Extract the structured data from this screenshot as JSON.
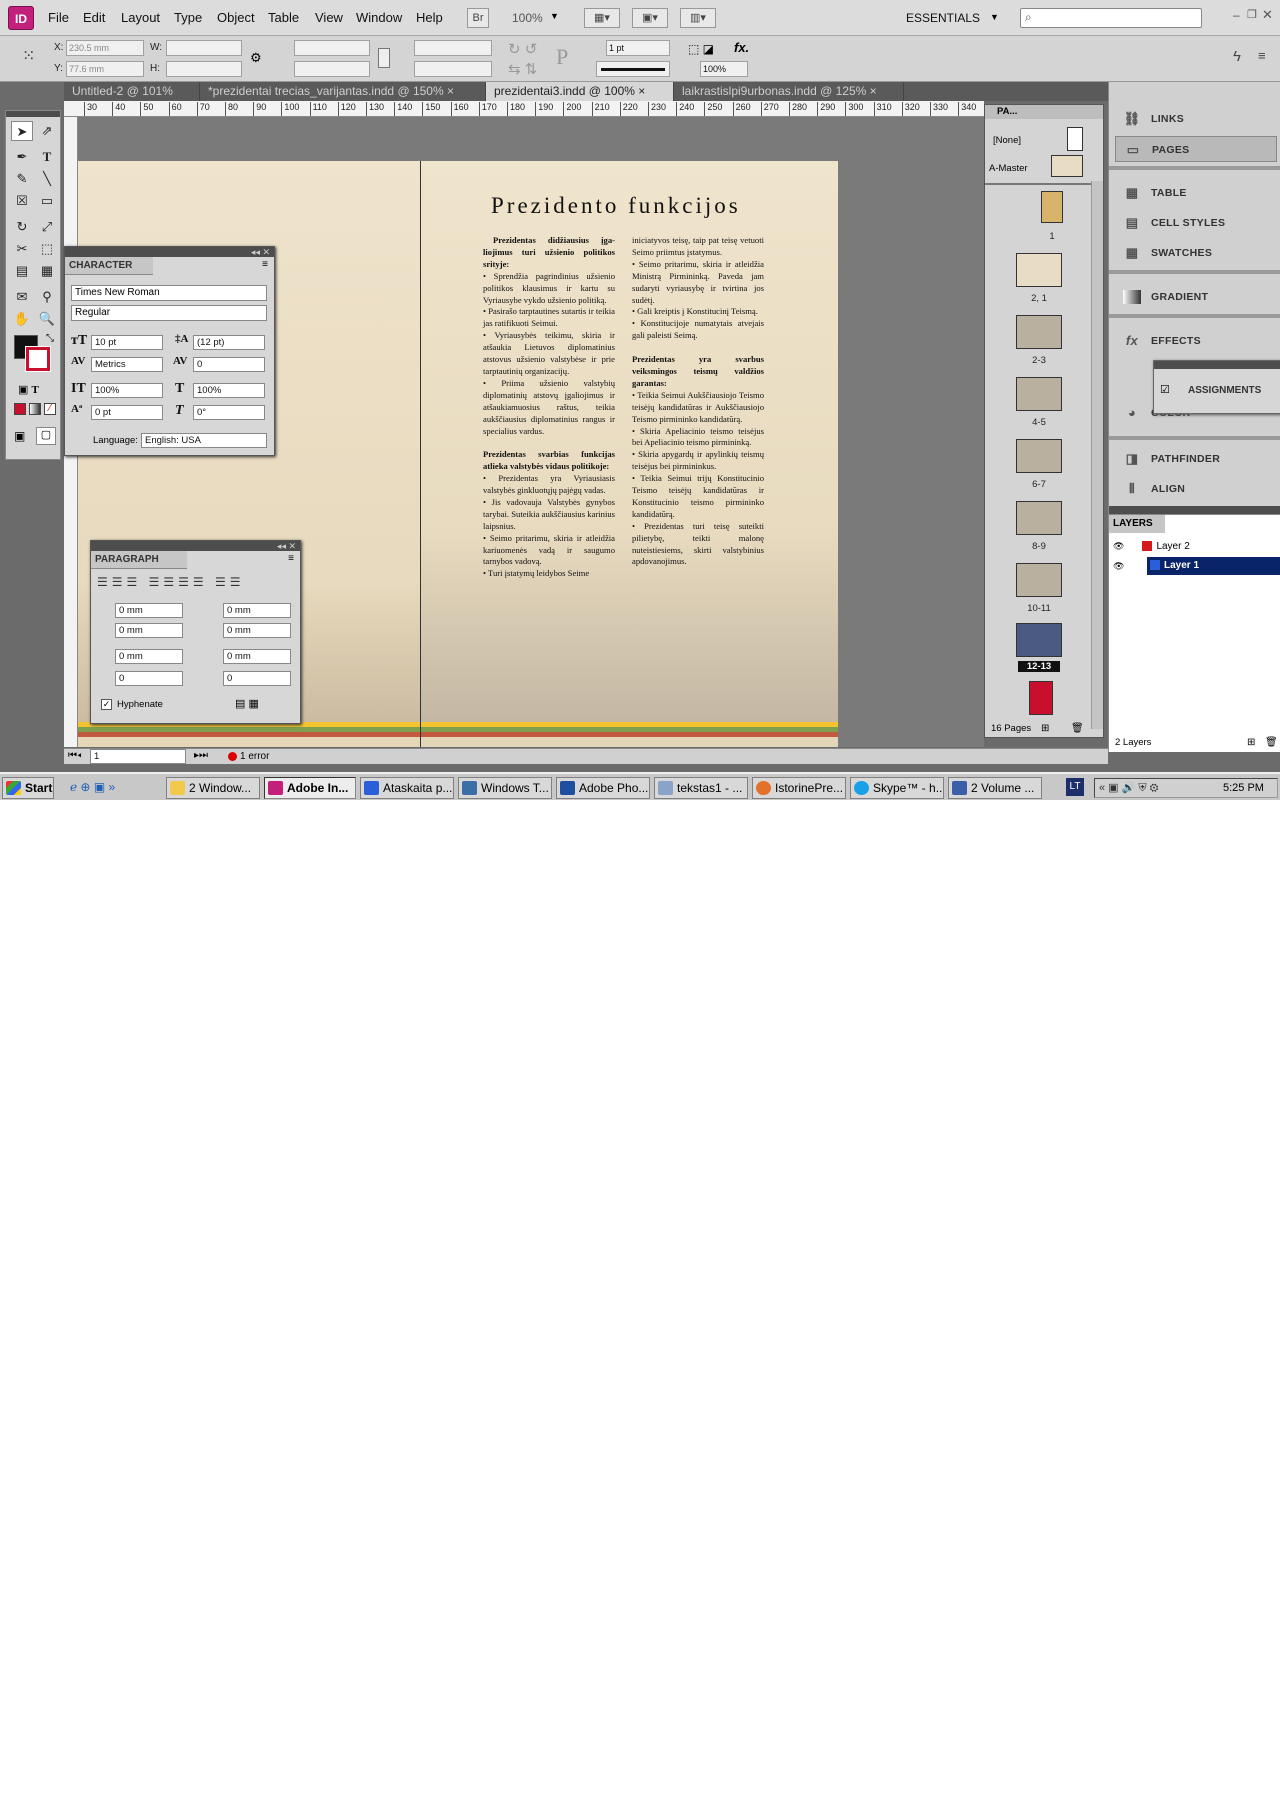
{
  "app": {
    "logo": "ID",
    "menus": [
      "File",
      "Edit",
      "Layout",
      "Type",
      "Object",
      "Table",
      "View",
      "Window",
      "Help"
    ],
    "bridge": "Br",
    "zoom": "100%",
    "workspace": "ESSENTIALS"
  },
  "control": {
    "x": "230.5 mm",
    "y": "77.6 mm",
    "x_label": "X:",
    "y_label": "Y:",
    "w_label": "W:",
    "h_label": "H:",
    "stroke_weight": "1 pt",
    "opacity": "100%"
  },
  "tabs": [
    "Untitled-2 @ 101%",
    "*prezidentai trecias_varijantas.indd @ 150%",
    "prezidentai3.indd @ 100%",
    "laikrastislpi9urbonas.indd @ 125%"
  ],
  "ruler": [
    "30",
    "40",
    "50",
    "60",
    "70",
    "80",
    "90",
    "100",
    "110",
    "120",
    "130",
    "140",
    "150",
    "160",
    "170",
    "180",
    "190",
    "200",
    "210",
    "220",
    "230",
    "240",
    "250",
    "260",
    "270",
    "280",
    "290",
    "300",
    "310",
    "320",
    "330",
    "340"
  ],
  "document": {
    "title": "Prezidento funkcijos",
    "page_number": "1",
    "col1_head1": "Prezidentas didžiausius įga-liojimus turi užsienio politikos srityje:",
    "col1_body1": "• Sprendžia pagrindinius užsienio politikos klausimus ir kartu su Vyriausybe vykdo užsienio politiką.\n• Pasirašo tarptautines sutartis ir teikia jas ratifikuoti Seimui.\n• Vyriausybės teikimu, skiria ir atšaukia Lietuvos diplomatinius atstovus užsienio valstybėse ir prie tarptautinių organizacijų.\n• Priima užsienio valstybių diplomatinių atstovų įgaliojimus ir atšaukiamuosius raštus, teikia aukščiausius diplomatinius rangus ir specialius vardus.",
    "col1_head2": "Prezidentas svarbias funkcijas atlieka valstybės vidaus politikoje:",
    "col1_body2": "• Prezidentas yra Vyriausiasis valstybės ginkluotųjų pajėgų vadas.\n• Jis vadovauja Valstybės gynybos tarybai. Suteikia aukščiausius karinius laipsnius.\n• Seimo pritarimu, skiria ir atleidžia kariuomenės vadą ir saugumo tarnybos vadovą.\n• Turi įstatymų leidybos Seime",
    "col2_body1": "iniciatyvos teisę, taip pat teisę vetuoti Seimo priimtus įstatymus.\n• Seimo pritarimu, skiria ir atleidžia Ministrą Pirmininką. Paveda jam sudaryti vyriausybę ir tvirtina jos sudėtį.\n• Gali kreiptis į Konstitucinį Teismą.\n• Konstitucijoje numatytais atvejais gali paleisti Seimą.",
    "col2_head2": "Prezidentas yra svarbus veiksmingos teismų valdžios garantas:",
    "col2_body2": "• Teikia Seimui Aukščiausiojo Teismo teisėjų kandidatūras ir Aukščiausiojo Teismo pirmininko kandidatūrą.\n• Skiria Apeliacinio teismo teisėjus bei Apeliacinio teismo pirmininką.\n• Skiria apygardų ir apylinkių teismų teisėjus bei pirmininkus.\n• Teikia Seimui trijų Konstitucinio Teismo teisėjų kandidatūras ir Konstitucinio teismo pirmininko kandidatūrą.\n• Prezidentas turi teisę suteikti pilietybę, teikti malonę nuteistiesiems, skirti valstybinius apdovanojimus."
  },
  "character": {
    "title": "CHARACTER",
    "font": "Times New Roman",
    "style": "Regular",
    "size": "10 pt",
    "leading": "(12 pt)",
    "kerning": "Metrics",
    "tracking": "0",
    "vscale": "100%",
    "hscale": "100%",
    "baseline": "0 pt",
    "skew": "0°",
    "language_label": "Language:",
    "language": "English: USA"
  },
  "paragraph": {
    "title": "PARAGRAPH",
    "left_indent": "0 mm",
    "right_indent": "0 mm",
    "first_indent": "0 mm",
    "last_indent": "0 mm",
    "space_before": "0 mm",
    "space_after": "0 mm",
    "drop_lines": "0",
    "drop_chars": "0",
    "hyphenate": "Hyphenate"
  },
  "pages": {
    "title": "PA...",
    "none": "[None]",
    "master": "A-Master",
    "labels": [
      "1",
      "2, 1",
      "2-3",
      "4-5",
      "6-7",
      "8-9",
      "10-11",
      "12-13"
    ],
    "count": "16 Pages"
  },
  "dock": {
    "items": [
      "LINKS",
      "PAGES",
      "TABLE",
      "CELL STYLES",
      "SWATCHES",
      "GRADIENT",
      "EFFECTS",
      "COLOR",
      "PATHFINDER",
      "ALIGN"
    ],
    "assignments": "ASSIGNMENTS",
    "layers_title": "LAYERS",
    "layers": [
      "Layer 2",
      "Layer 1"
    ],
    "layers_count": "2 Layers"
  },
  "status": {
    "page": "1",
    "errors": "1 error"
  },
  "taskbar": {
    "start": "Start",
    "tasks": [
      "2 Window...",
      "Adobe In...",
      "Ataskaita p...",
      "Windows T...",
      "Adobe Pho...",
      "tekstas1 - ...",
      "IstorinePre...",
      "Skype™ - h...",
      "2 Volume ..."
    ],
    "clock": "5:25 PM",
    "tray_lang": "LT"
  },
  "colors": {
    "accent": "#c2207a",
    "layer2": "#d41c1c",
    "layer1": "#2b5fd9",
    "selection": "#0a246a"
  }
}
